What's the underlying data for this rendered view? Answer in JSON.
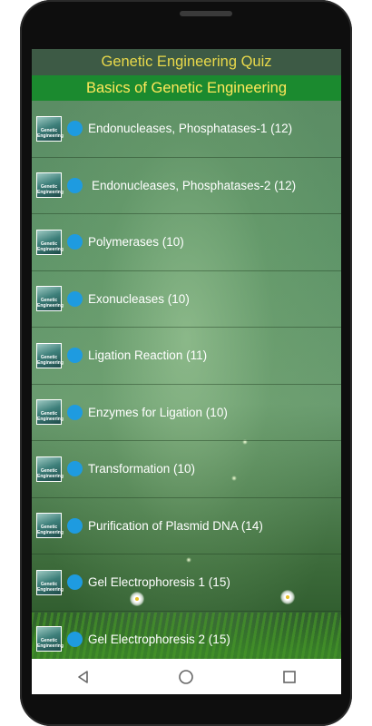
{
  "app_title": "Genetic Engineering Quiz",
  "section_title": "Basics of Genetic Engineering",
  "thumbnail": {
    "line1": "Genetic",
    "line2": "Engineering"
  },
  "items": [
    {
      "label": "Endonucleases, Phosphatases-1 (12)"
    },
    {
      "label": "Endonucleases, Phosphatases-2 (12)"
    },
    {
      "label": "Polymerases (10)"
    },
    {
      "label": "Exonucleases (10)"
    },
    {
      "label": "Ligation Reaction (11)"
    },
    {
      "label": "Enzymes for Ligation (10)"
    },
    {
      "label": "Transformation (10)"
    },
    {
      "label": "Purification of Plasmid DNA (14)"
    },
    {
      "label": "Gel Electrophoresis 1 (15)"
    },
    {
      "label": "Gel Electrophoresis 2 (15)"
    }
  ],
  "nav": {
    "back_icon": "triangle-back-icon",
    "home_icon": "circle-home-icon",
    "recents_icon": "square-recents-icon"
  },
  "colors": {
    "appbar": "#3d5a45",
    "subbar": "#1b8a2f",
    "title_text": "#e8d84a",
    "dot": "#1e9be0"
  }
}
